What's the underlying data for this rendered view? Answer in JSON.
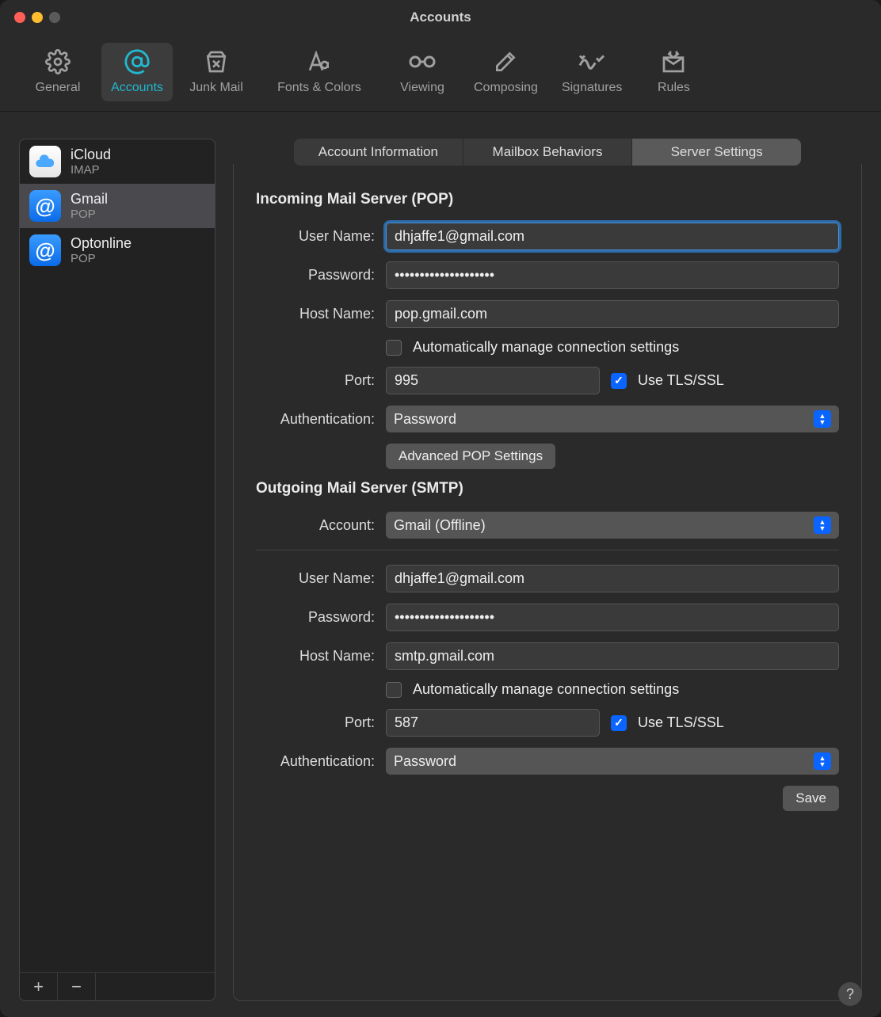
{
  "window": {
    "title": "Accounts"
  },
  "toolbar": {
    "items": [
      {
        "id": "general",
        "label": "General"
      },
      {
        "id": "accounts",
        "label": "Accounts"
      },
      {
        "id": "junk",
        "label": "Junk Mail"
      },
      {
        "id": "fonts",
        "label": "Fonts & Colors"
      },
      {
        "id": "viewing",
        "label": "Viewing"
      },
      {
        "id": "composing",
        "label": "Composing"
      },
      {
        "id": "signatures",
        "label": "Signatures"
      },
      {
        "id": "rules",
        "label": "Rules"
      }
    ],
    "active": "accounts"
  },
  "sidebar": {
    "accounts": [
      {
        "name": "iCloud",
        "sub": "IMAP",
        "icon": "icloud"
      },
      {
        "name": "Gmail",
        "sub": "POP",
        "icon": "at",
        "selected": true
      },
      {
        "name": "Optonline",
        "sub": "POP",
        "icon": "at"
      }
    ],
    "add_label": "+",
    "remove_label": "−"
  },
  "subtabs": {
    "items": [
      "Account Information",
      "Mailbox Behaviors",
      "Server Settings"
    ],
    "active": 2
  },
  "incoming": {
    "section_title": "Incoming Mail Server (POP)",
    "username_label": "User Name:",
    "username": "dhjaffe1@gmail.com",
    "password_label": "Password:",
    "password": "••••••••••••••••••••",
    "host_label": "Host Name:",
    "host": "pop.gmail.com",
    "auto_label": "Automatically manage connection settings",
    "auto_checked": false,
    "port_label": "Port:",
    "port": "995",
    "tls_label": "Use TLS/SSL",
    "tls_checked": true,
    "auth_label": "Authentication:",
    "auth_value": "Password",
    "advanced_button": "Advanced POP Settings"
  },
  "outgoing": {
    "section_title": "Outgoing Mail Server (SMTP)",
    "account_label": "Account:",
    "account_value": "Gmail (Offline)",
    "username_label": "User Name:",
    "username": "dhjaffe1@gmail.com",
    "password_label": "Password:",
    "password": "••••••••••••••••••••",
    "host_label": "Host Name:",
    "host": "smtp.gmail.com",
    "auto_label": "Automatically manage connection settings",
    "auto_checked": false,
    "port_label": "Port:",
    "port": "587",
    "tls_label": "Use TLS/SSL",
    "tls_checked": true,
    "auth_label": "Authentication:",
    "auth_value": "Password"
  },
  "buttons": {
    "save": "Save"
  },
  "help": "?"
}
